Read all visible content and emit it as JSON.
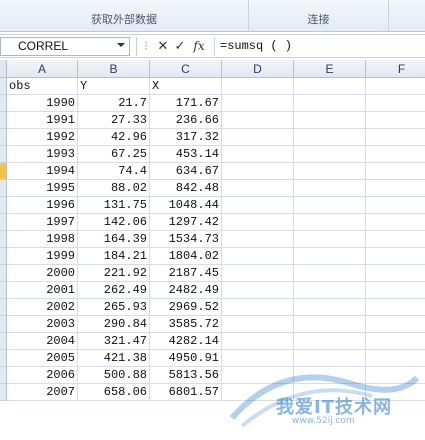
{
  "ribbon": {
    "groups": [
      {
        "label": "获取外部数据"
      },
      {
        "label": "连接"
      }
    ]
  },
  "formula_bar": {
    "name_box": "CORREL",
    "cancel_icon": "✕",
    "enter_icon": "✓",
    "fx_label": "fx",
    "formula": "=sumsq ( )"
  },
  "grid": {
    "columns": [
      "A",
      "B",
      "C",
      "D",
      "E",
      "F"
    ],
    "active_row_index": 5,
    "rows": [
      [
        "obs",
        "Y",
        "X"
      ],
      [
        "1990",
        "21.7",
        "171.67"
      ],
      [
        "1991",
        "27.33",
        "236.66"
      ],
      [
        "1992",
        "42.96",
        "317.32"
      ],
      [
        "1993",
        "67.25",
        "453.14"
      ],
      [
        "1994",
        "74.4",
        "634.67"
      ],
      [
        "1995",
        "88.02",
        "842.48"
      ],
      [
        "1996",
        "131.75",
        "1048.44"
      ],
      [
        "1997",
        "142.06",
        "1297.42"
      ],
      [
        "1998",
        "164.39",
        "1534.73"
      ],
      [
        "1999",
        "184.21",
        "1804.02"
      ],
      [
        "2000",
        "221.92",
        "2187.45"
      ],
      [
        "2001",
        "262.49",
        "2482.49"
      ],
      [
        "2002",
        "265.93",
        "2969.52"
      ],
      [
        "2003",
        "290.84",
        "3585.72"
      ],
      [
        "2004",
        "321.47",
        "4282.14"
      ],
      [
        "2005",
        "421.38",
        "4950.91"
      ],
      [
        "2006",
        "500.88",
        "5813.56"
      ],
      [
        "2007",
        "658.06",
        "6801.57"
      ]
    ]
  },
  "watermark": {
    "text": "我爱IT技术网",
    "sub": "www.52ij.com"
  },
  "colors": {
    "ribbon_bg": "#e3ebf5",
    "header_bg": "#e1e8f0",
    "active_row": "#f5c34a",
    "watermark": "#2878c8"
  }
}
